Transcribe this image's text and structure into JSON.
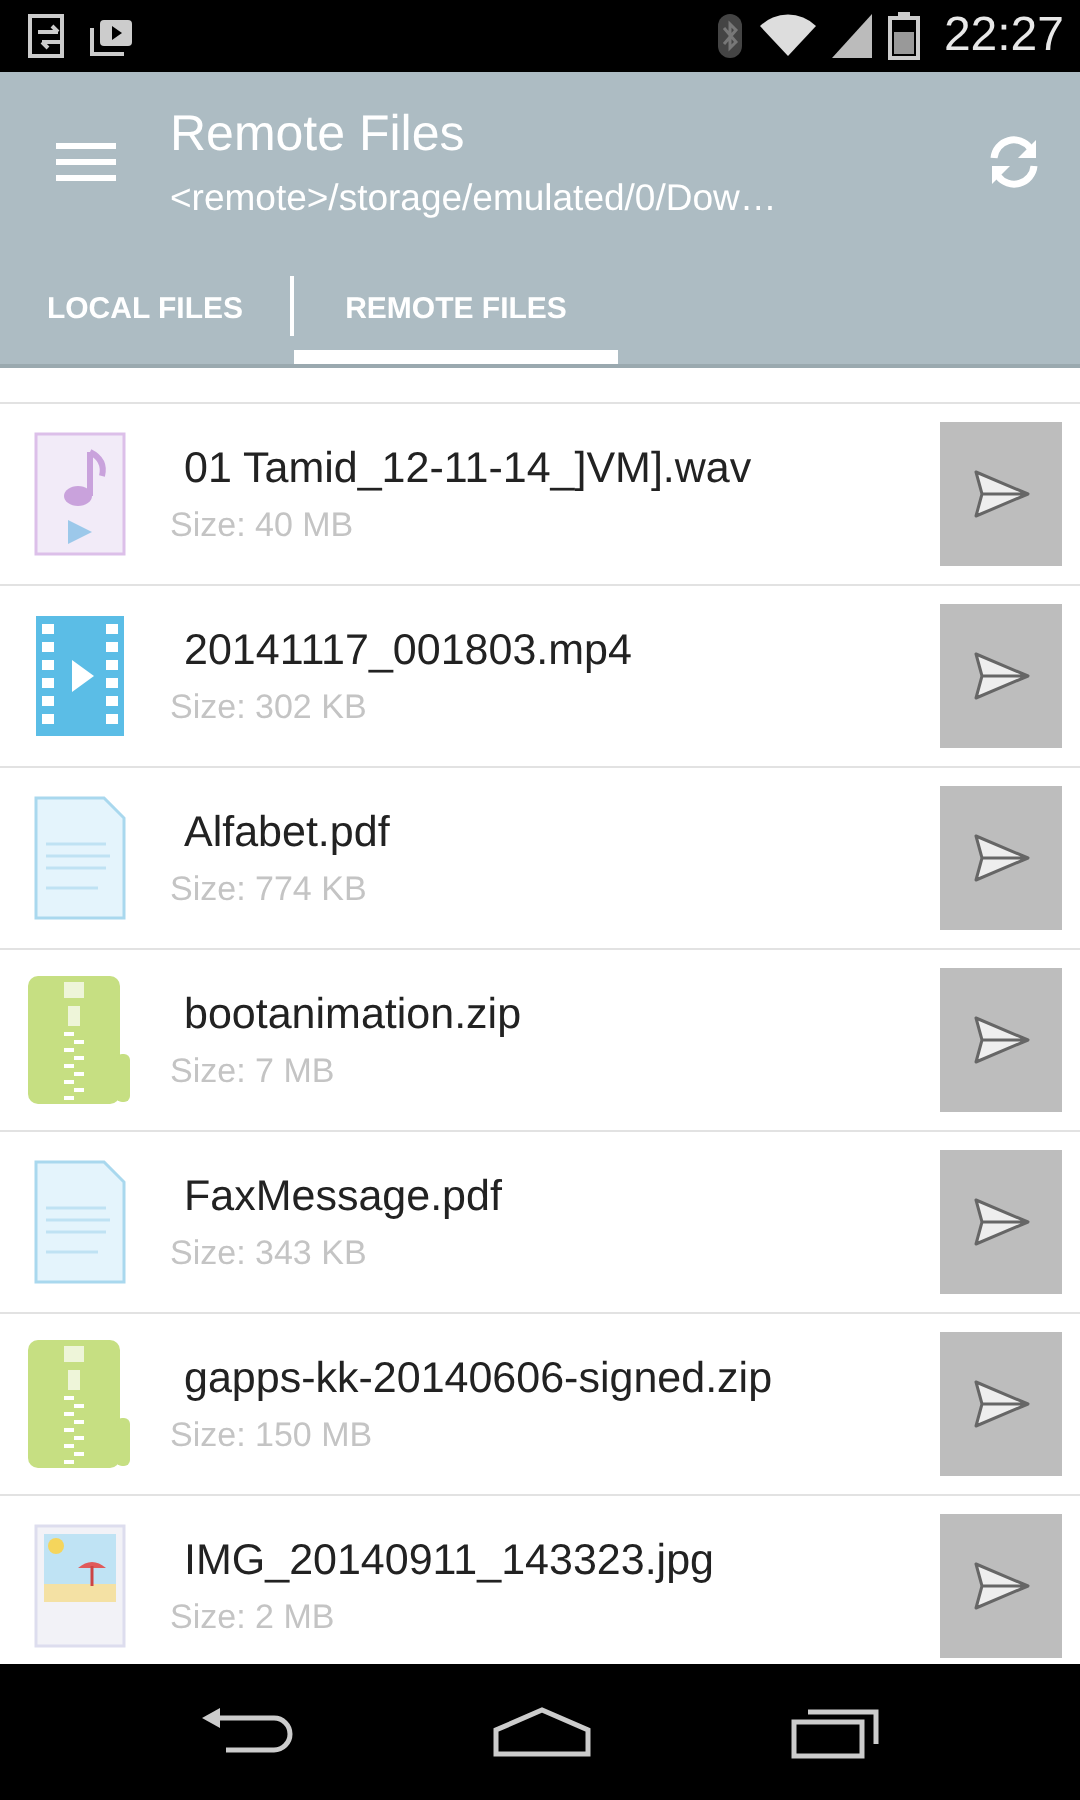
{
  "status_bar": {
    "time": "22:27"
  },
  "app_bar": {
    "title": "Remote Files",
    "subtitle": "<remote>/storage/emulated/0/Dow…"
  },
  "tabs": [
    {
      "label": "LOCAL FILES",
      "selected": false
    },
    {
      "label": "REMOTE FILES",
      "selected": true
    }
  ],
  "files": [
    {
      "kind": "audio",
      "name": "01 Tamid_12-11-14_]VM].wav",
      "size": "Size: 40 MB"
    },
    {
      "kind": "video",
      "name": "20141117_001803.mp4",
      "size": "Size: 302 KB"
    },
    {
      "kind": "document",
      "name": "Alfabet.pdf",
      "size": "Size: 774 KB"
    },
    {
      "kind": "archive",
      "name": "bootanimation.zip",
      "size": "Size: 7 MB"
    },
    {
      "kind": "document",
      "name": "FaxMessage.pdf",
      "size": "Size: 343 KB"
    },
    {
      "kind": "archive",
      "name": "gapps-kk-20140606-signed.zip",
      "size": "Size: 150 MB"
    },
    {
      "kind": "image",
      "name": "IMG_20140911_143323.jpg",
      "size": "Size: 2 MB"
    }
  ]
}
